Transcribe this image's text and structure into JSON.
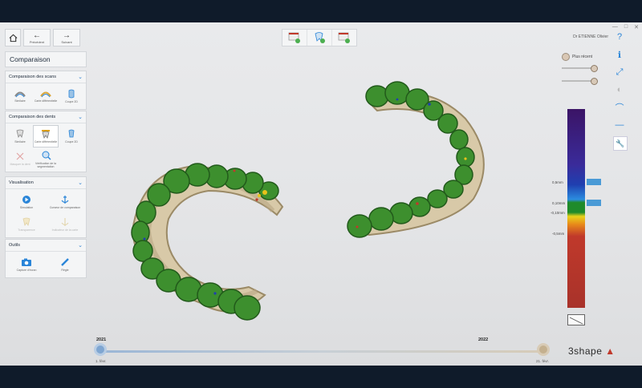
{
  "window": {
    "minimize": "—",
    "maximize": "□",
    "close": "✕"
  },
  "nav": {
    "home_icon": "home-icon",
    "prev_label": "Précédent",
    "next_label": "Suivant"
  },
  "panel": {
    "title": "Comparaison",
    "scans": {
      "header": "Comparaison des scans",
      "tools": [
        "Similaire",
        "Carte différentielle",
        "Coupe 2D"
      ]
    },
    "teeth": {
      "header": "Comparaison des dents",
      "tools": [
        "Similaire",
        "Carte différentielle",
        "Coupe 2D",
        "Masquer la dent",
        "Vérification de la segmentation"
      ]
    },
    "visualisation": {
      "header": "Visualisation",
      "tools": [
        "Simulation",
        "Curseur de comparaison",
        "Transparence",
        "Indicateur de la carte"
      ]
    },
    "outils": {
      "header": "Outils",
      "tools": [
        "Capture d'écran",
        "Règle"
      ]
    }
  },
  "user": {
    "name": "Dr ETIENNE Olivier"
  },
  "right_tools": [
    "help-icon",
    "info-icon",
    "fit-view-icon",
    "opacity-icon",
    "curve-icon",
    "minus-icon",
    "settings-icon"
  ],
  "display": {
    "plus_label": "Plus récent",
    "slider1": 0.95,
    "slider2": 0.95
  },
  "colorbar": {
    "labels": [
      "0,5mm",
      "0,10mm",
      "-0,10mm",
      "-0,5mm"
    ],
    "colors": {
      "top": "#3b1466",
      "blue": "#1f3fb0",
      "green": "#1f8b2b",
      "yellow": "#e8d21a",
      "red": "#a8322a"
    }
  },
  "timeline": {
    "year_start": "2021",
    "year_end": "2022",
    "date_start": "1. févr.",
    "date_end": "21. févr."
  },
  "brand": {
    "name": "3shape"
  }
}
